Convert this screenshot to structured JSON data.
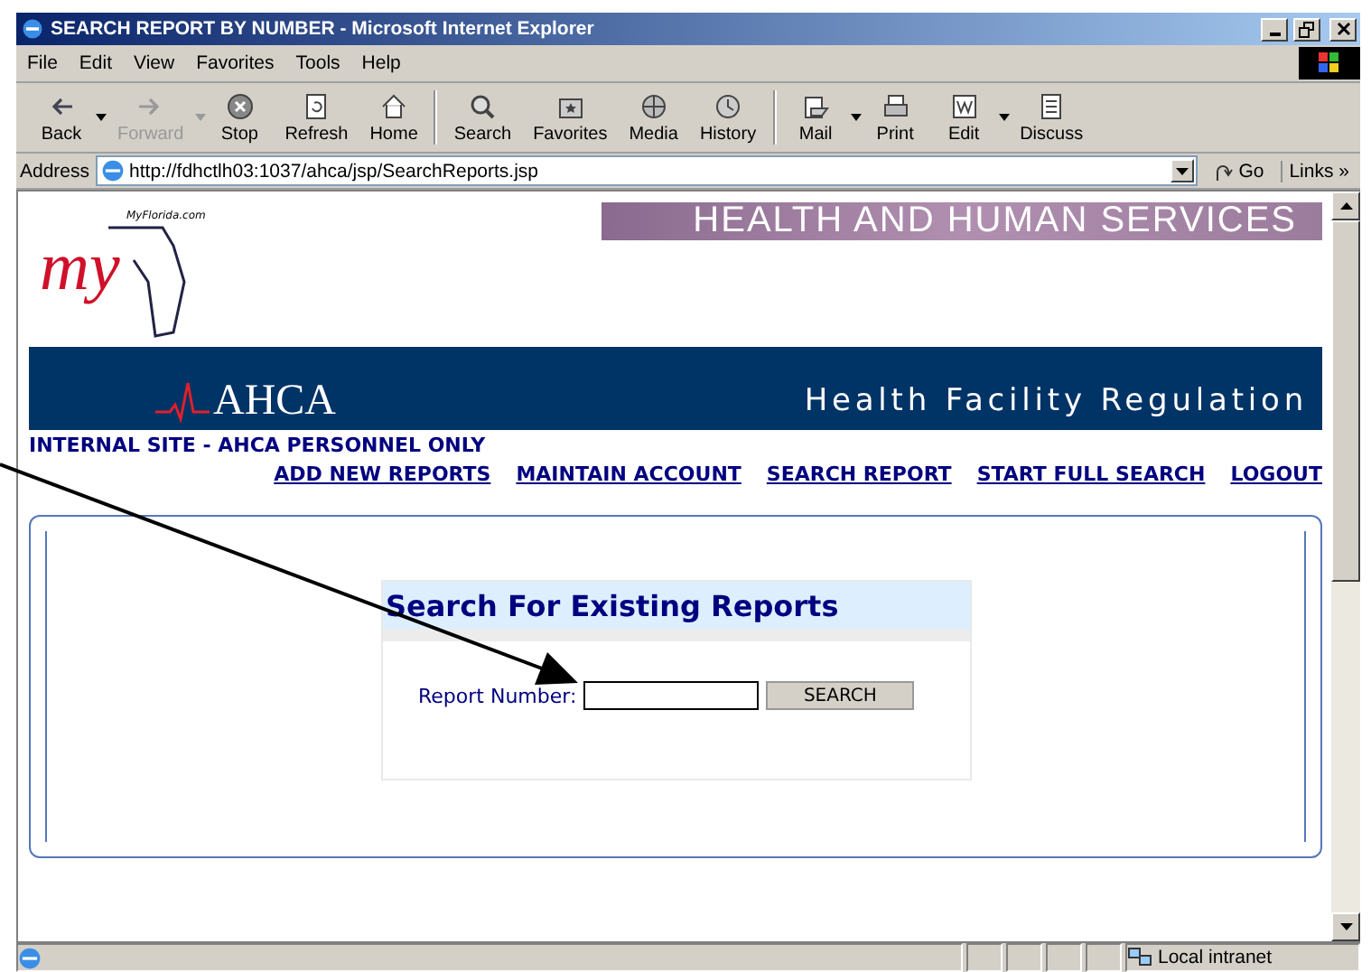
{
  "window": {
    "title": "SEARCH REPORT BY NUMBER - Microsoft Internet Explorer"
  },
  "menu": [
    "File",
    "Edit",
    "View",
    "Favorites",
    "Tools",
    "Help"
  ],
  "toolbar": [
    {
      "label": "Back",
      "disabled": false,
      "has_menu": true
    },
    {
      "label": "Forward",
      "disabled": true,
      "has_menu": true
    },
    {
      "label": "Stop",
      "disabled": false,
      "has_menu": false
    },
    {
      "label": "Refresh",
      "disabled": false,
      "has_menu": false
    },
    {
      "label": "Home",
      "disabled": false,
      "has_menu": false
    },
    {
      "label": "Search",
      "disabled": false,
      "has_menu": false
    },
    {
      "label": "Favorites",
      "disabled": false,
      "has_menu": false
    },
    {
      "label": "Media",
      "disabled": false,
      "has_menu": false
    },
    {
      "label": "History",
      "disabled": false,
      "has_menu": false
    },
    {
      "label": "Mail",
      "disabled": false,
      "has_menu": true
    },
    {
      "label": "Print",
      "disabled": false,
      "has_menu": false
    },
    {
      "label": "Edit",
      "disabled": false,
      "has_menu": true
    },
    {
      "label": "Discuss",
      "disabled": false,
      "has_menu": false
    }
  ],
  "address_bar": {
    "label": "Address",
    "url": "http://fdhctlh03:1037/ahca/jsp/SearchReports.jsp",
    "go": "Go",
    "links": "Links",
    "links_chevron": "»"
  },
  "page": {
    "logo_caption": "MyFlorida.com",
    "logo_text": "my",
    "top_banner": "HEALTH AND HUMAN SERVICES",
    "agency": "AHCA",
    "division": "Health Facility Regulation",
    "notice": "INTERNAL SITE - AHCA PERSONNEL ONLY",
    "nav_links": [
      "ADD NEW REPORTS",
      "MAINTAIN ACCOUNT",
      "SEARCH REPORT",
      "START FULL SEARCH",
      "LOGOUT"
    ],
    "search_form": {
      "heading": "Search For Existing Reports",
      "field_label": "Report Number:",
      "button": "SEARCH"
    }
  },
  "status_bar": {
    "zone": "Local intranet"
  }
}
